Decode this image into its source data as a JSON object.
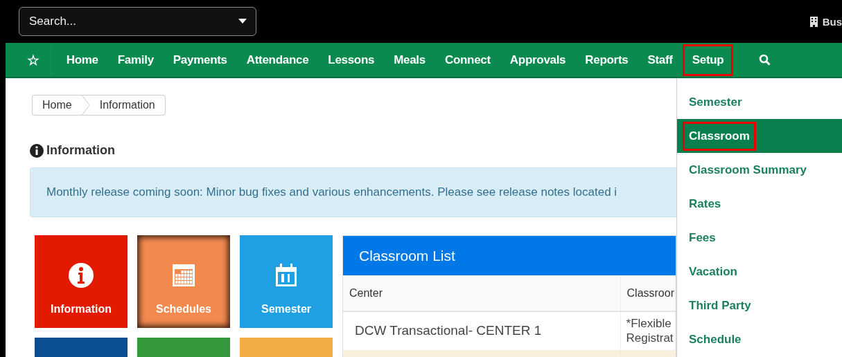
{
  "top_bar": {
    "search": {
      "placeholder": "Search..."
    },
    "business_label": "Bus"
  },
  "nav": {
    "items": [
      {
        "kind": "star",
        "label": "☆",
        "highlighted": false
      },
      {
        "kind": "link",
        "label": "Home",
        "highlighted": false
      },
      {
        "kind": "link",
        "label": "Family",
        "highlighted": false
      },
      {
        "kind": "link",
        "label": "Payments",
        "highlighted": false
      },
      {
        "kind": "link",
        "label": "Attendance",
        "highlighted": false
      },
      {
        "kind": "link",
        "label": "Lessons",
        "highlighted": false
      },
      {
        "kind": "link",
        "label": "Meals",
        "highlighted": false
      },
      {
        "kind": "link",
        "label": "Connect",
        "highlighted": false
      },
      {
        "kind": "link",
        "label": "Approvals",
        "highlighted": false
      },
      {
        "kind": "link",
        "label": "Reports",
        "highlighted": false
      },
      {
        "kind": "link",
        "label": "Staff",
        "highlighted": false
      },
      {
        "kind": "link",
        "label": "Setup",
        "highlighted": true
      },
      {
        "kind": "search",
        "highlighted": false
      }
    ]
  },
  "breadcrumb": [
    "Home",
    "Information"
  ],
  "page_title": "Information",
  "alert": "Monthly release coming soon: Minor bug fixes and various enhancements. Please see release notes located i",
  "tiles": [
    {
      "label": "Information",
      "kind": "info",
      "color": "#e41a00",
      "hovered": false
    },
    {
      "label": "Schedules",
      "kind": "calendar",
      "color": "#f28a50",
      "hovered": true
    },
    {
      "label": "Semester",
      "kind": "date",
      "color": "#1ea0e2",
      "hovered": false
    },
    {
      "kind": "blank",
      "color": "#0a4f91",
      "hovered": false
    },
    {
      "kind": "blank",
      "color": "#34993a",
      "hovered": false
    },
    {
      "kind": "blank",
      "color": "#f2ac45",
      "hovered": false
    }
  ],
  "classroom_list": {
    "title": "Classroom List",
    "columns": [
      "Center",
      "Classroor"
    ],
    "rows": [
      {
        "cells": [
          "DCW Transactional- CENTER 1",
          "*Flexible\nRegistrat"
        ]
      }
    ]
  },
  "setup_menu": {
    "items": [
      {
        "label": "Semester",
        "selected": false,
        "highlighted": false
      },
      {
        "label": "Classroom",
        "selected": true,
        "highlighted": true
      },
      {
        "label": "Classroom Summary",
        "selected": false,
        "highlighted": false
      },
      {
        "label": "Rates",
        "selected": false,
        "highlighted": false
      },
      {
        "label": "Fees",
        "selected": false,
        "highlighted": false
      },
      {
        "label": "Vacation",
        "selected": false,
        "highlighted": false
      },
      {
        "label": "Third Party",
        "selected": false,
        "highlighted": false
      },
      {
        "label": "Schedule",
        "selected": false,
        "highlighted": false
      }
    ]
  }
}
